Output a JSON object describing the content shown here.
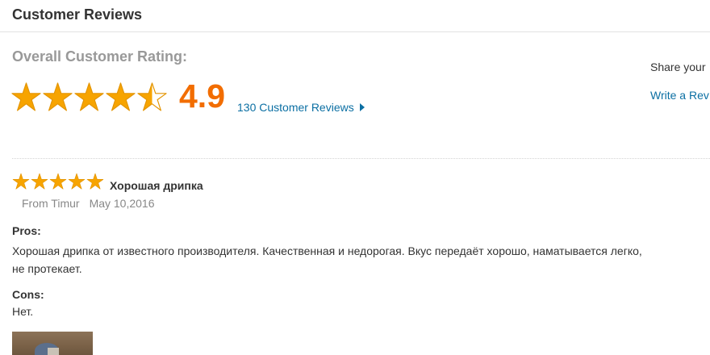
{
  "header": {
    "title": "Customer Reviews"
  },
  "overall": {
    "label": "Overall Customer Rating:",
    "rating": 4.5,
    "score": "4.9",
    "reviews_link": "130 Customer Reviews",
    "star_color": "#f7a400",
    "score_color": "#f26d00"
  },
  "share": {
    "text": "Share your",
    "write_link": "Write a Rev"
  },
  "review": {
    "rating": 5,
    "title": "Хорошая дрипка",
    "author": "From Timur",
    "date": "May 10,2016",
    "pros_label": "Pros:",
    "pros_text": "Хорошая дрипка от известного производителя. Качественная и недорогая. Вкус передаёт хорошо, наматывается легко, не протекает.",
    "cons_label": "Cons:",
    "cons_text": "Нет."
  },
  "colors": {
    "link": "#0b6fa3",
    "muted": "#999999"
  }
}
